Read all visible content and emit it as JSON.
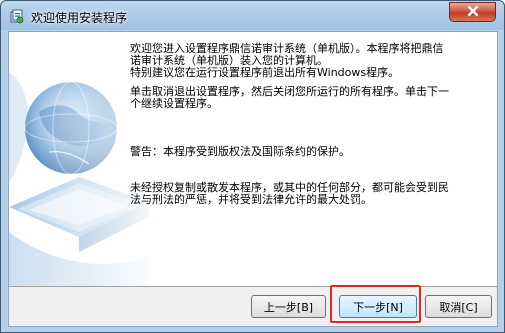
{
  "window": {
    "title": "欢迎使用安装程序"
  },
  "content": {
    "paragraphs": [
      "欢迎您进入设置程序鼎信诺审计系统（单机版）。本程序将把鼎信\n诺审计系统（单机版）装入您的计算机。\n特别建议您在运行设置程序前退出所有Windows程序。",
      "单击取消退出设置程序，然后关闭您所运行的所有程序。单击下一\n个继续设置程序。",
      "警告：本程序受到版权法及国际条约的保护。",
      "未经授权复制或散发本程序，或其中的任何部分，都可能会受到民\n法与刑法的严惩，并将受到法律允许的最大处罚。"
    ]
  },
  "buttons": {
    "back": "上一步[B]",
    "next": "下一步[N]",
    "cancel": "取消[C]"
  },
  "colors": {
    "highlight": "#e8262a",
    "close": "#c23a25"
  },
  "icons": {
    "app": "installer-icon",
    "close": "close-icon",
    "art": "globe-laptop-illustration"
  }
}
